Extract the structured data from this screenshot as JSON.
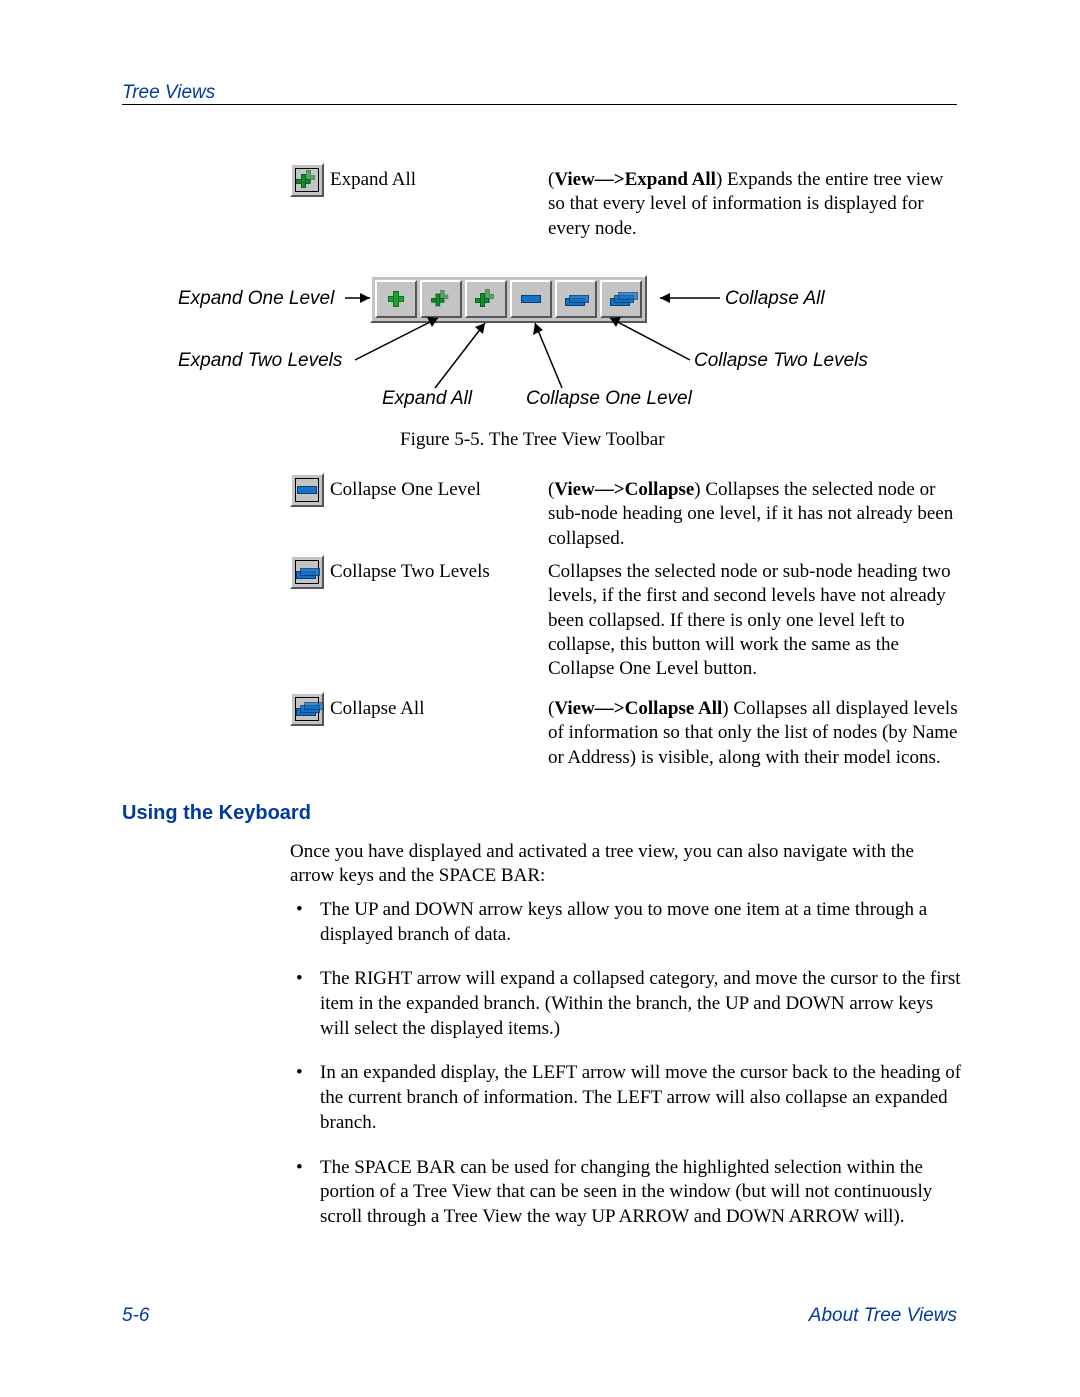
{
  "header": {
    "title": "Tree Views"
  },
  "expand_all_row": {
    "label": "Expand All",
    "desc_bold": "View—>Expand All",
    "desc_rest": ") Expands the entire tree view so that every level of information is displayed for every node."
  },
  "toolbar_labels": {
    "expand_one": "Expand One Level",
    "expand_two": "Expand Two Levels",
    "expand_all": "Expand All",
    "collapse_one": "Collapse One Level",
    "collapse_two": "Collapse Two Levels",
    "collapse_all": "Collapse All"
  },
  "figure_caption": "Figure 5-5.  The Tree View Toolbar",
  "collapse_one_row": {
    "label": "Collapse One Level",
    "desc_bold": "View—>Collapse",
    "desc_rest": ") Collapses the selected node or sub-node heading one level, if it has not already been collapsed."
  },
  "collapse_two_row": {
    "label": "Collapse Two Levels",
    "desc": "Collapses the selected node or sub-node heading two levels, if the first and second levels have not already been collapsed. If there is only one level left to collapse, this button will work the same as the Collapse One Level button."
  },
  "collapse_all_row": {
    "label": "Collapse All",
    "desc_bold": "View—>Collapse All",
    "desc_rest": ") Collapses all displayed levels of information so that only the list of nodes (by Name or Address) is visible, along with their model icons."
  },
  "keyboard": {
    "heading": "Using the Keyboard",
    "intro": "Once you have displayed and activated a tree view, you can also navigate with the arrow keys and the SPACE BAR:",
    "bullets": [
      "The UP and DOWN arrow keys allow you to move one item at a time through a displayed branch of data.",
      "The RIGHT arrow will expand a collapsed category, and move the cursor to the first item in the expanded branch. (Within the branch, the UP and DOWN arrow keys will select the displayed items.)",
      "In an expanded display, the LEFT arrow will move the cursor back to the heading of the current branch of information. The LEFT arrow will also collapse an expanded branch.",
      "The SPACE BAR can be used for changing the highlighted selection within the portion of a Tree View that can be seen in the window (but will not continuously scroll through a Tree View the way UP ARROW and DOWN ARROW will)."
    ]
  },
  "footer": {
    "left": "5-6",
    "right": "About Tree Views"
  }
}
